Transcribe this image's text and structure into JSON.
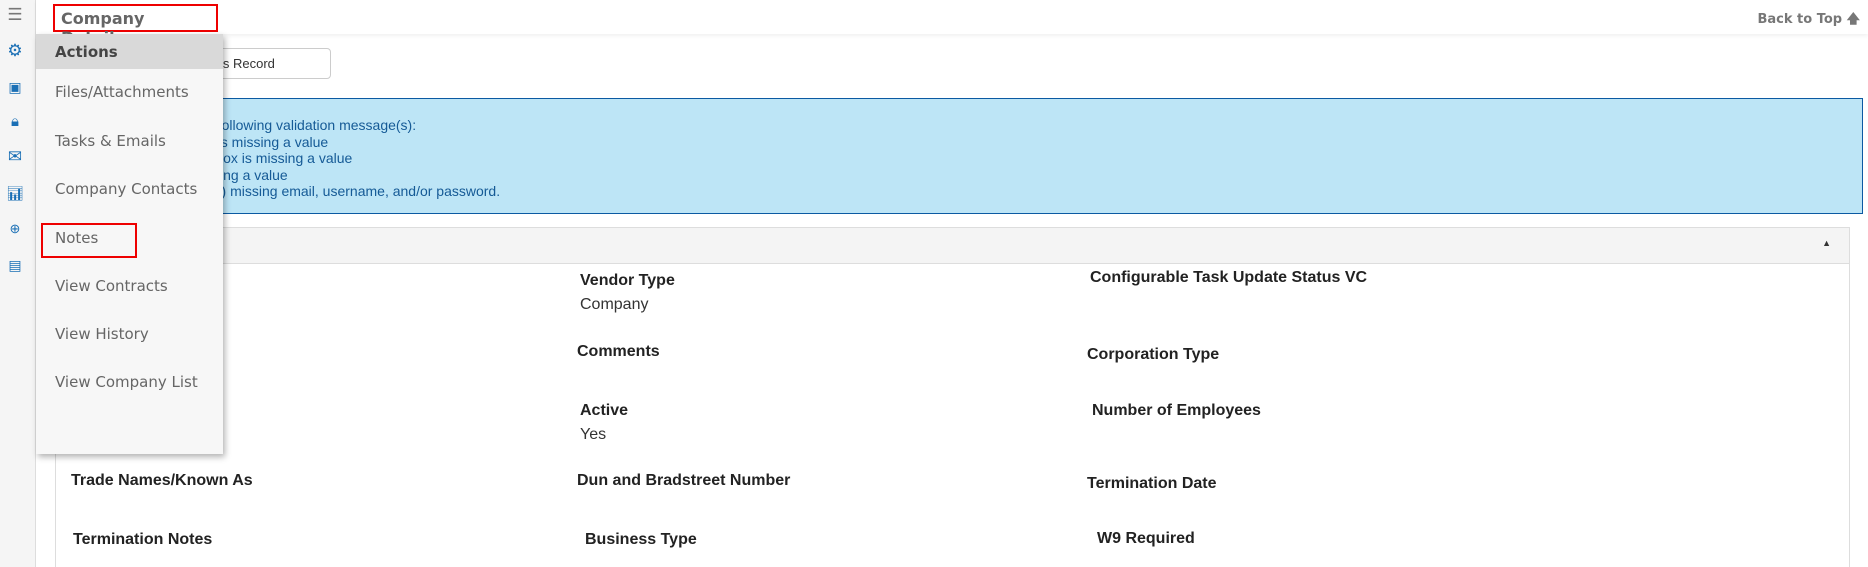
{
  "header": {
    "title": "Company Details",
    "back_to_top": "Back to Top",
    "back_icon": "arrow-up-icon"
  },
  "sidebar": {
    "icons": [
      "menu-icon",
      "gear-icon",
      "file-settings-icon",
      "lock-icon",
      "mail-icon",
      "chart-icon",
      "org-add-icon",
      "report-settings-icon"
    ]
  },
  "record_button": {
    "label": "ns for this Record"
  },
  "alert": {
    "lines": [
      "e following validation message(s):",
      "e is missing a value",
      "t Box is missing a value",
      "ssing a value",
      "t(s) missing email, username, and/or password."
    ]
  },
  "actions_menu": {
    "title": "Actions",
    "items": [
      "Files/Attachments",
      "Tasks & Emails",
      "Company Contacts",
      "Notes",
      "View Contracts",
      "View History",
      "View Company List"
    ]
  },
  "fields": [
    {
      "label": "Vendor Type",
      "value": "Company"
    },
    {
      "label": "Configurable Task Update Status VC",
      "value": ""
    },
    {
      "label": "Comments",
      "value": ""
    },
    {
      "label": "Corporation Type",
      "value": ""
    },
    {
      "label": "Active",
      "value": "Yes"
    },
    {
      "label": "Number of Employees",
      "value": ""
    },
    {
      "label": "Trade Names/Known As",
      "value": ""
    },
    {
      "label": "Dun and Bradstreet Number",
      "value": ""
    },
    {
      "label": "Termination Date",
      "value": ""
    },
    {
      "label": "Termination Notes",
      "value": ""
    },
    {
      "label": "Business Type",
      "value": ""
    },
    {
      "label": "W9 Required",
      "value": ""
    }
  ],
  "colors": {
    "accent": "#1a6fb5",
    "alert_bg": "#bde5f6",
    "alert_border": "#0b5aa2",
    "highlight": "#ee0000"
  }
}
